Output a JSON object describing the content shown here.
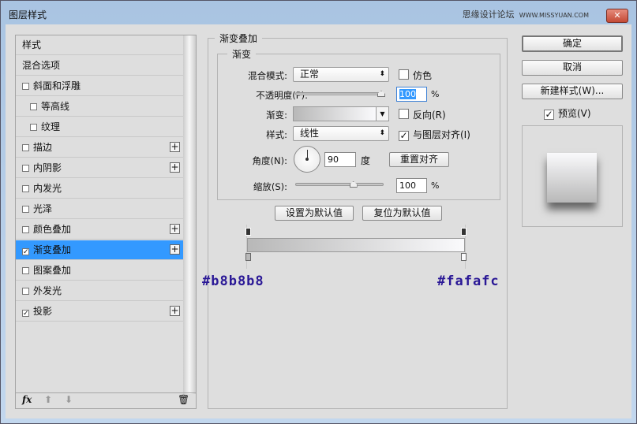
{
  "window": {
    "title": "图层样式",
    "watermark": "思缘设计论坛",
    "watermark_url": "WWW.MISSYUAN.COM"
  },
  "sidebar": {
    "items": [
      {
        "label": "样式",
        "checkbox": false,
        "checked": false,
        "plus": false,
        "indent": false
      },
      {
        "label": "混合选项",
        "checkbox": false,
        "checked": false,
        "plus": false,
        "indent": false
      },
      {
        "label": "斜面和浮雕",
        "checkbox": true,
        "checked": false,
        "plus": false,
        "indent": false
      },
      {
        "label": "等高线",
        "checkbox": true,
        "checked": false,
        "plus": false,
        "indent": true
      },
      {
        "label": "纹理",
        "checkbox": true,
        "checked": false,
        "plus": false,
        "indent": true
      },
      {
        "label": "描边",
        "checkbox": true,
        "checked": false,
        "plus": true,
        "indent": false
      },
      {
        "label": "内阴影",
        "checkbox": true,
        "checked": false,
        "plus": true,
        "indent": false
      },
      {
        "label": "内发光",
        "checkbox": true,
        "checked": false,
        "plus": false,
        "indent": false
      },
      {
        "label": "光泽",
        "checkbox": true,
        "checked": false,
        "plus": false,
        "indent": false
      },
      {
        "label": "颜色叠加",
        "checkbox": true,
        "checked": false,
        "plus": true,
        "indent": false
      },
      {
        "label": "渐变叠加",
        "checkbox": true,
        "checked": true,
        "plus": true,
        "indent": false,
        "selected": true
      },
      {
        "label": "图案叠加",
        "checkbox": true,
        "checked": false,
        "plus": false,
        "indent": false
      },
      {
        "label": "外发光",
        "checkbox": true,
        "checked": false,
        "plus": false,
        "indent": false
      },
      {
        "label": "投影",
        "checkbox": true,
        "checked": true,
        "plus": true,
        "indent": false
      }
    ],
    "footer": {
      "fx": "fx"
    }
  },
  "panel": {
    "title": "渐变叠加",
    "group": "渐变",
    "blend_mode_label": "混合模式:",
    "blend_mode": "正常",
    "dither_label": "仿色",
    "opacity_label": "不透明度(P):",
    "opacity": "100",
    "opacity_unit": "%",
    "opacity_value": 100,
    "gradient_label": "渐变:",
    "reverse_label": "反向(R)",
    "style_label": "样式:",
    "style": "线性",
    "align_label": "与图层对齐(I)",
    "angle_label": "角度(N):",
    "angle": "90",
    "angle_unit": "度",
    "reset_align": "重置对齐",
    "scale_label": "缩放(S):",
    "scale": "100",
    "scale_unit": "%",
    "scale_value": 100,
    "set_default": "设置为默认值",
    "reset_default": "复位为默认值",
    "color_start": "#b8b8b8",
    "color_end": "#fafafc"
  },
  "buttons": {
    "ok": "确定",
    "cancel": "取消",
    "new_style": "新建样式(W)...",
    "preview": "预览(V)"
  }
}
